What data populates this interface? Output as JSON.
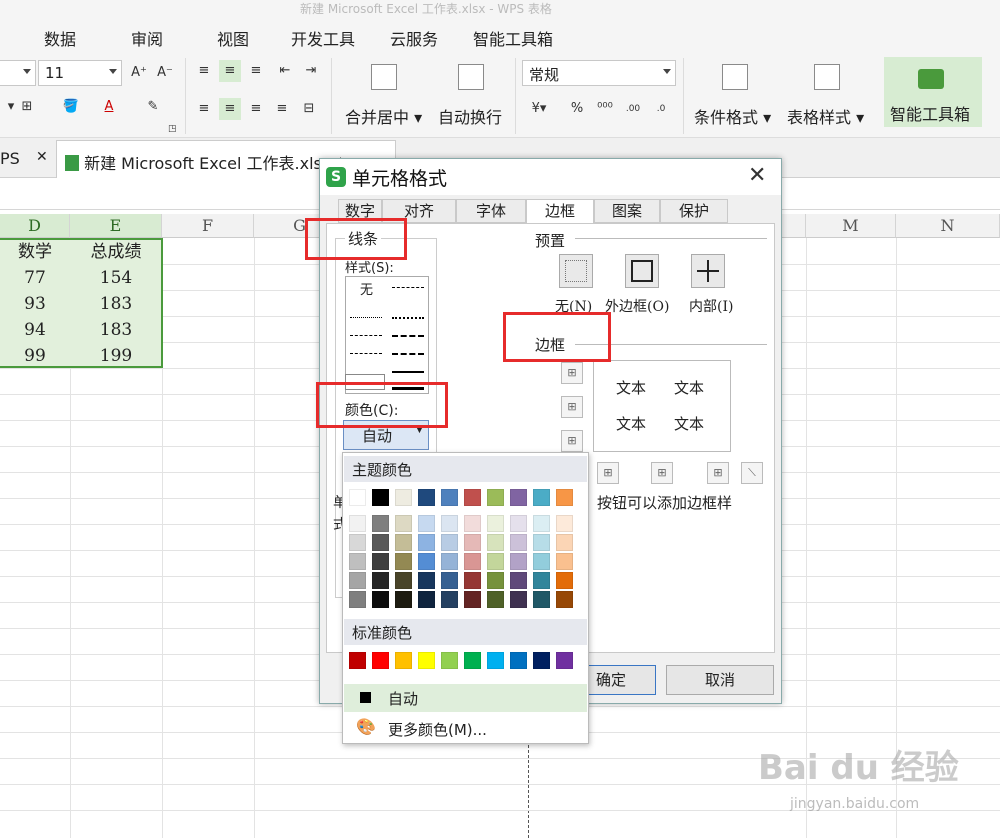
{
  "window": {
    "title": "新建 Microsoft Excel 工作表.xlsx - WPS 表格"
  },
  "menu": [
    "数据",
    "审阅",
    "视图",
    "开发工具",
    "云服务",
    "智能工具箱"
  ],
  "ribbon": {
    "font_size": "11",
    "number_format": "常规",
    "merge_center": "合并居中",
    "wrap_text": "自动换行",
    "cond_format": "条件格式",
    "table_style": "表格样式",
    "smart_toolbox": "智能工具箱"
  },
  "tabs": {
    "left_partial": "PS",
    "file": "新建 Microsoft Excel 工作表.xlsx *"
  },
  "sheet": {
    "columns": [
      "D",
      "E",
      "F",
      "G",
      "M",
      "N"
    ],
    "header_row": [
      "数学",
      "总成绩"
    ],
    "rows": [
      [
        "77",
        "154"
      ],
      [
        "93",
        "183"
      ],
      [
        "94",
        "183"
      ],
      [
        "99",
        "199"
      ]
    ]
  },
  "dialog": {
    "title": "单元格格式",
    "close": "✕",
    "tabs": [
      "数字",
      "对齐",
      "字体",
      "边框",
      "图案",
      "保护"
    ],
    "active_tab": "边框",
    "line_group": "线条",
    "style_label": "样式(S):",
    "style_none": "无",
    "color_label": "颜色(C):",
    "color_value": "自动",
    "preset_group": "预置",
    "presets": [
      "无(N)",
      "外边框(O)",
      "内部(I)"
    ],
    "border_group": "边框",
    "preview_text": "文本",
    "hint_left": "单",
    "hint_left2": "式",
    "hint_right": "按钮可以添加边框样",
    "ok": "确定",
    "cancel": "取消"
  },
  "color_popup": {
    "theme_title": "主题颜色",
    "theme_top": [
      "#ffffff",
      "#000000",
      "#eeece1",
      "#1f497d",
      "#4f81bd",
      "#c0504d",
      "#9bbb59",
      "#8064a2",
      "#4bacc6",
      "#f79646"
    ],
    "theme_shades": [
      [
        "#f2f2f2",
        "#7f7f7f",
        "#ddd9c3",
        "#c6d9f0",
        "#dbe5f1",
        "#f2dcdb",
        "#ebf1dd",
        "#e5e0ec",
        "#dbeef3",
        "#fdeada"
      ],
      [
        "#d8d8d8",
        "#595959",
        "#c4bd97",
        "#8db3e2",
        "#b8cce4",
        "#e5b9b7",
        "#d7e3bc",
        "#ccc1d9",
        "#b7dde8",
        "#fbd5b5"
      ],
      [
        "#bfbfbf",
        "#3f3f3f",
        "#938953",
        "#548dd4",
        "#95b3d7",
        "#d99694",
        "#c3d69b",
        "#b2a2c7",
        "#92cddc",
        "#fac08f"
      ],
      [
        "#a5a5a5",
        "#262626",
        "#494429",
        "#17365d",
        "#366092",
        "#953734",
        "#76923c",
        "#5f497a",
        "#31859b",
        "#e36c09"
      ],
      [
        "#7f7f7f",
        "#0c0c0c",
        "#1d1b10",
        "#0f243e",
        "#244061",
        "#632423",
        "#4f6128",
        "#3f3151",
        "#205867",
        "#974806"
      ]
    ],
    "standard_title": "标准颜色",
    "standard": [
      "#c00000",
      "#ff0000",
      "#ffc000",
      "#ffff00",
      "#92d050",
      "#00b050",
      "#00b0f0",
      "#0070c0",
      "#002060",
      "#7030a0"
    ],
    "auto": "自动",
    "more": "更多颜色(M)..."
  },
  "watermark": {
    "brand": "Bai du 经验",
    "url": "jingyan.baidu.com"
  }
}
